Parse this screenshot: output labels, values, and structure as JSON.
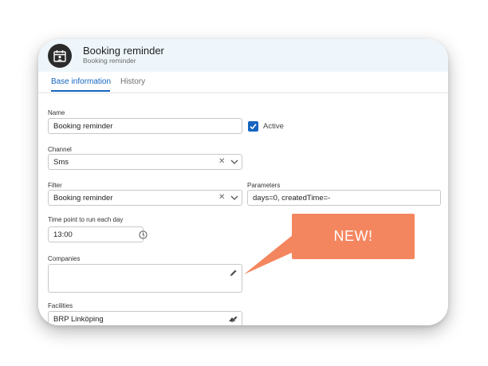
{
  "header": {
    "title": "Booking reminder",
    "subtitle": "Booking reminder",
    "icon": "calendar-person-icon"
  },
  "tabs": [
    {
      "label": "Base information",
      "active": true
    },
    {
      "label": "History",
      "active": false
    }
  ],
  "form": {
    "name": {
      "label": "Name",
      "value": "Booking reminder"
    },
    "active": {
      "label": "Active",
      "checked": true
    },
    "channel": {
      "label": "Channel",
      "value": "Sms"
    },
    "filter": {
      "label": "Filter",
      "value": "Booking reminder"
    },
    "parameters": {
      "label": "Parameters",
      "value": "days=0, createdTime=-"
    },
    "time_point": {
      "label": "Time point to run each day",
      "value": "13:00"
    },
    "companies": {
      "label": "Companies",
      "value": ""
    },
    "facilities": {
      "label": "Facilities",
      "value": "BRP Linköping"
    }
  },
  "callout": {
    "text": "NEW!"
  },
  "colors": {
    "accent": "#1565c0",
    "header_bg": "#eef6fb",
    "callout": "#f4865f"
  }
}
